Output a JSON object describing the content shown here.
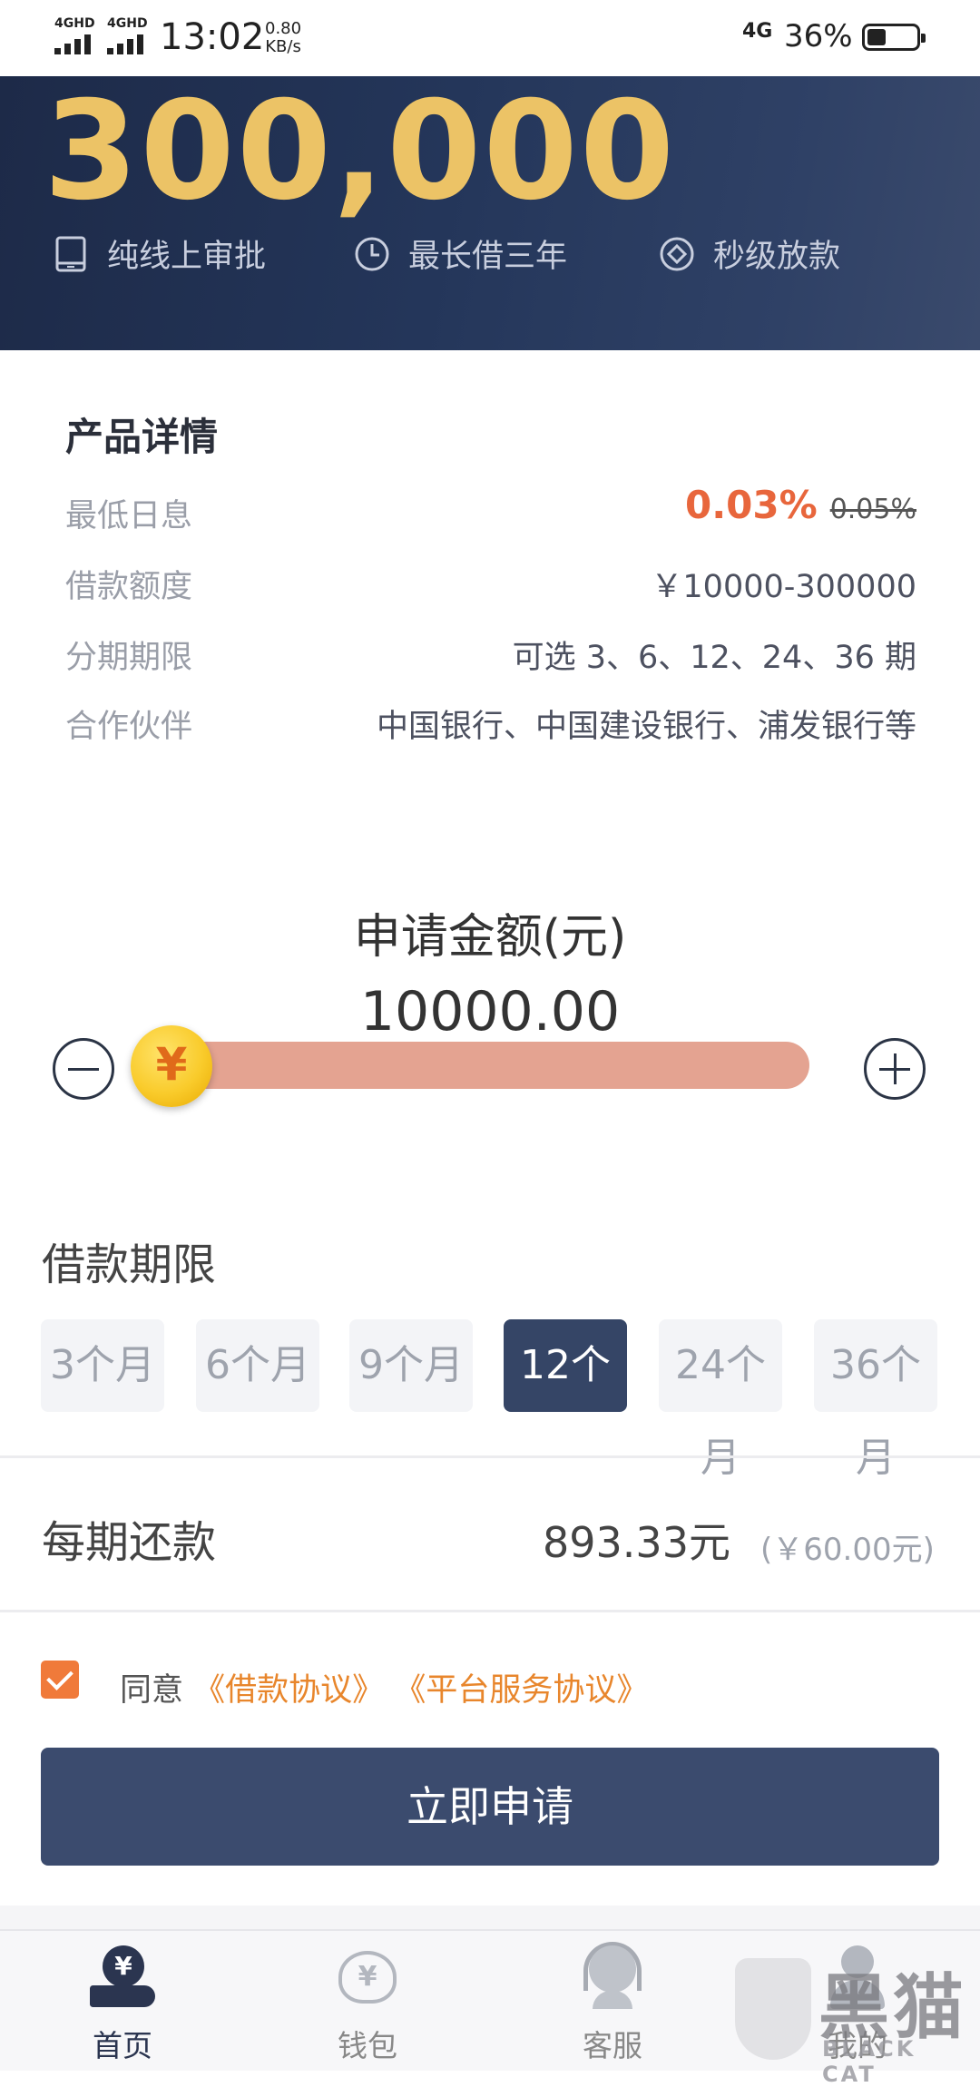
{
  "status_bar": {
    "network_1": "4GHD",
    "network_2": "4GHD",
    "time": "13:02",
    "speed_value": "0.80",
    "speed_unit": "KB/s",
    "network_type": "4G",
    "battery": "36%"
  },
  "hero": {
    "max_amount": "300,000",
    "features": [
      {
        "label": "纯线上审批",
        "icon": "phone-icon"
      },
      {
        "label": "最长借三年",
        "icon": "clock-icon"
      },
      {
        "label": "秒级放款",
        "icon": "diamond-coin-icon"
      }
    ]
  },
  "product": {
    "title": "产品详情",
    "min_rate_label": "最低日息",
    "min_rate": "0.03%",
    "old_rate": "0.05%",
    "amount_label": "借款额度",
    "amount_range": "￥10000-300000",
    "term_label": "分期期限",
    "term_options": "可选 3、6、12、24、36 期",
    "partners_label": "合作伙伴",
    "partners": "中国银行、中国建设银行、浦发银行等"
  },
  "apply": {
    "label": "申请金额(元)",
    "value": "10000.00",
    "currency_symbol": "¥",
    "slider_fraction": 0.0
  },
  "term": {
    "label": "借款期限",
    "options": [
      "3个月",
      "6个月",
      "9个月",
      "12个月",
      "24个月",
      "36个月"
    ],
    "selected": "12个月"
  },
  "repayment": {
    "label": "每期还款",
    "amount": "893.33元",
    "fee": "(￥60.00元)"
  },
  "agreement": {
    "checked": true,
    "prefix": "同意",
    "loan_agreement": "《借款协议》",
    "service_agreement": "《平台服务协议》"
  },
  "cta": {
    "label": "立即申请"
  },
  "nav": {
    "items": [
      {
        "label": "首页",
        "icon": "home-yuan-icon"
      },
      {
        "label": "钱包",
        "icon": "wallet-bag-icon"
      },
      {
        "label": "客服",
        "icon": "customer-service-icon"
      },
      {
        "label": "我的",
        "icon": "profile-icon"
      }
    ],
    "active": "首页"
  },
  "watermark": {
    "title": "黑猫",
    "subtitle": "BLACK CAT"
  },
  "colors": {
    "accent_orange": "#e8663c",
    "navy": "#354566",
    "gold": "#ecc366",
    "slider": "#e4a391",
    "link": "#e8862c"
  }
}
